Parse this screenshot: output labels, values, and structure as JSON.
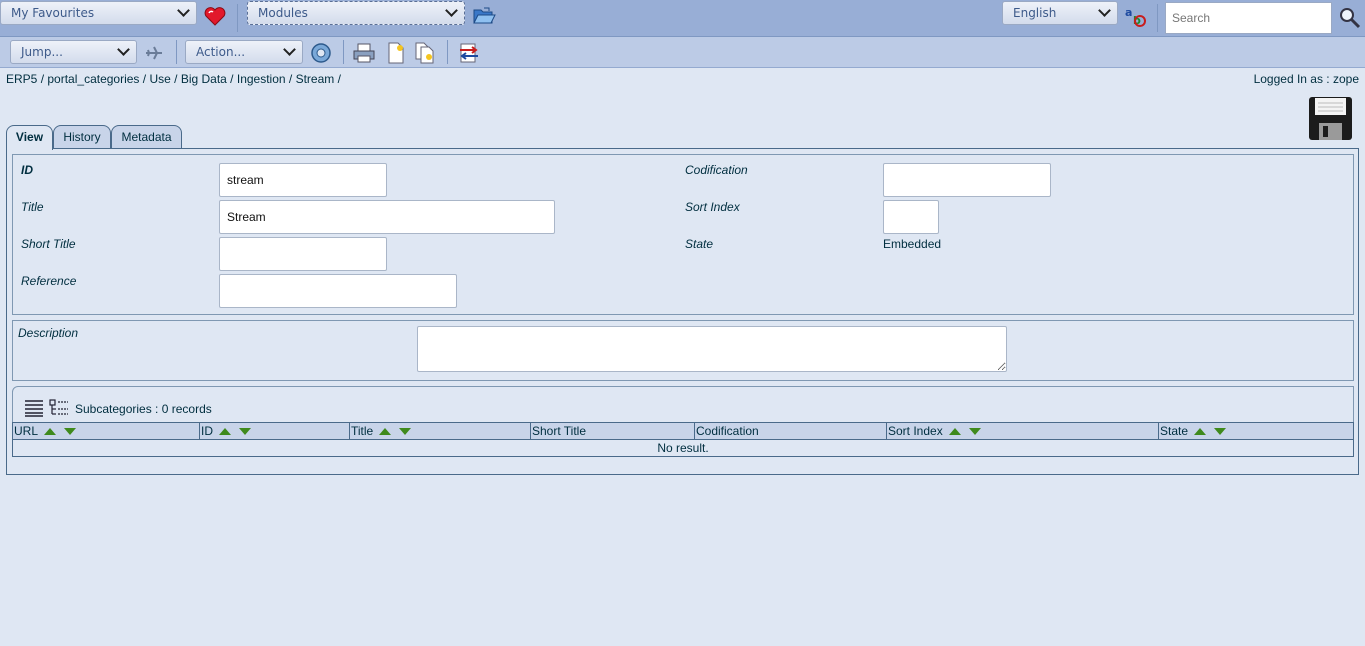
{
  "topbar": {
    "favourites_label": "My Favourites",
    "modules_label": "Modules",
    "language_label": "English",
    "search_placeholder": "Search"
  },
  "toolbar": {
    "jump_label": "Jump...",
    "action_label": "Action..."
  },
  "breadcrumb": [
    "ERP5",
    "portal_categories",
    "Use",
    "Big Data",
    "Ingestion",
    "Stream"
  ],
  "logged_in": "Logged In as : zope",
  "tabs": [
    {
      "label": "View",
      "active": true
    },
    {
      "label": "History",
      "active": false
    },
    {
      "label": "Metadata",
      "active": false
    }
  ],
  "form": {
    "id_label": "ID",
    "id_value": "stream",
    "title_label": "Title",
    "title_value": "Stream",
    "short_title_label": "Short Title",
    "short_title_value": "",
    "reference_label": "Reference",
    "reference_value": "",
    "codification_label": "Codification",
    "codification_value": "",
    "sort_index_label": "Sort Index",
    "sort_index_value": "",
    "state_label": "State",
    "state_value": "Embedded",
    "description_label": "Description",
    "description_value": ""
  },
  "listbox": {
    "title": "Subcategories :  0 records",
    "columns": [
      "URL",
      "ID",
      "Title",
      "Short Title",
      "Codification",
      "Sort Index",
      "State"
    ],
    "empty_text": "No result."
  }
}
